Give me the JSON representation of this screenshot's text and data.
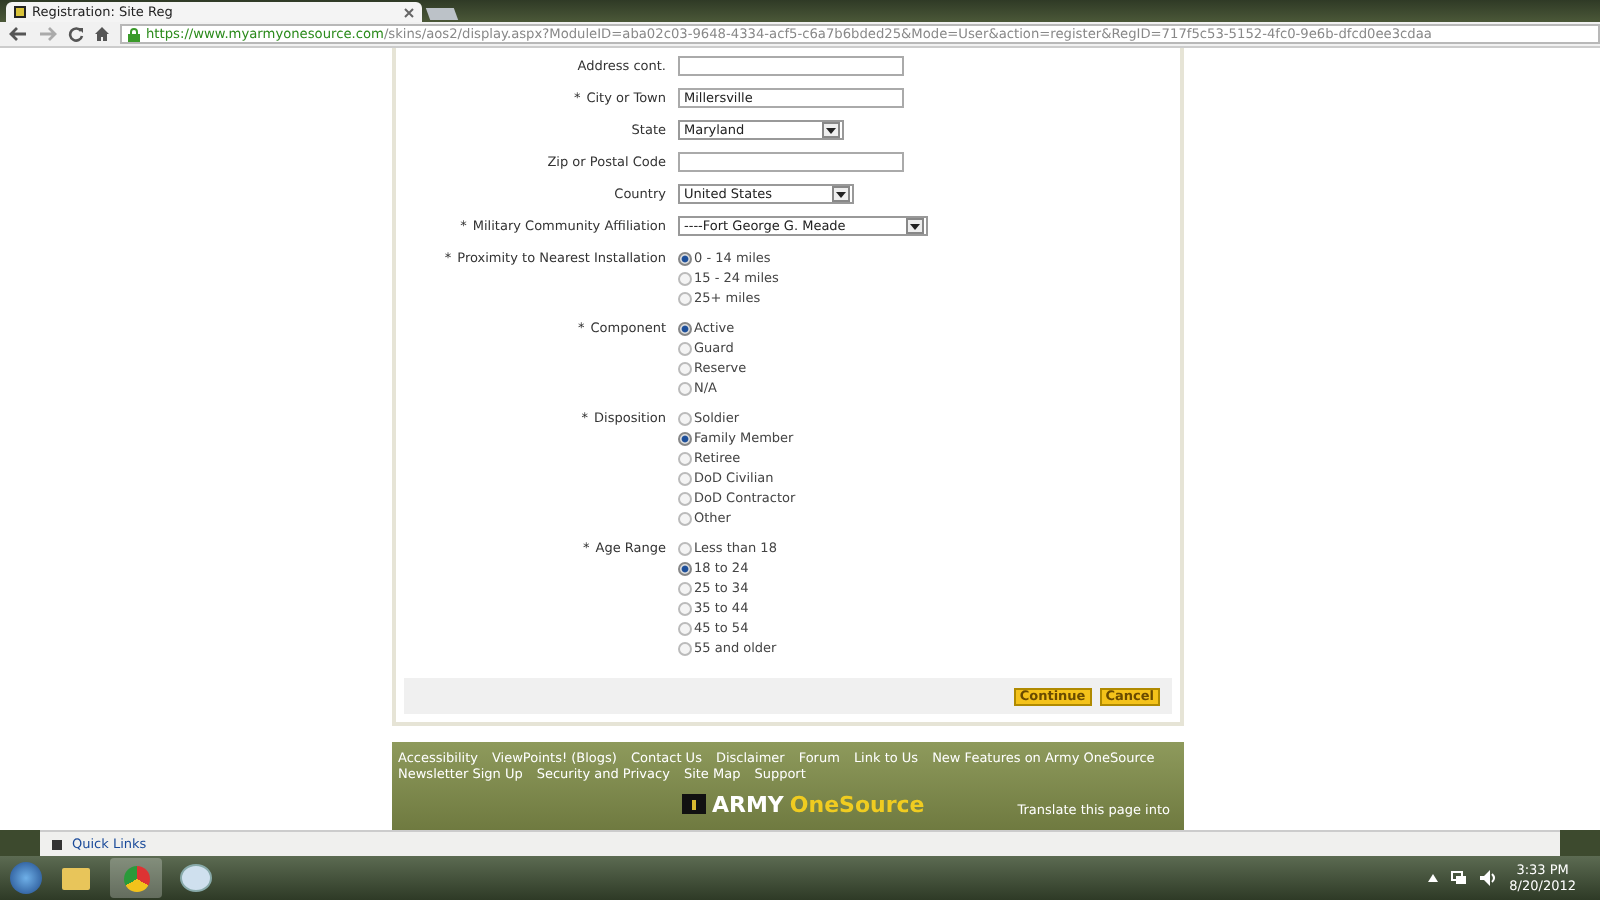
{
  "browser": {
    "tab_title": "Registration: Site Reg",
    "url_host": "https://www.myarmyonesource.com",
    "url_path": "/skins/aos2/display.aspx?ModuleID=aba02c03-9648-4334-acf5-c6a7b6bded25&Mode=User&action=register&RegID=717f5c53-5152-4fc0-9e6b-dfcd0ee3cdaa"
  },
  "form": {
    "fields": [
      {
        "kind": "text",
        "label": "Address cont.",
        "required": false
      },
      {
        "kind": "text",
        "label": "City or Town",
        "required": true,
        "value": "Millersville"
      },
      {
        "kind": "select",
        "label": "State",
        "required": false,
        "value": "Maryland"
      },
      {
        "kind": "text",
        "label": "Zip or Postal Code",
        "required": false
      },
      {
        "kind": "select",
        "label": "Country",
        "required": false,
        "value": "United States"
      },
      {
        "kind": "select",
        "label": "Military Community Affiliation",
        "required": true,
        "value": "----Fort George G. Meade"
      },
      {
        "kind": "radio",
        "label": "Proximity to Nearest Installation",
        "required": true,
        "options": [
          {
            "label": "0 - 14 miles",
            "selected": true
          },
          {
            "label": "15 - 24 miles",
            "selected": false
          },
          {
            "label": "25+ miles",
            "selected": false
          }
        ]
      },
      {
        "kind": "radio",
        "label": "Component",
        "required": true,
        "options": [
          {
            "label": "Active",
            "selected": true
          },
          {
            "label": "Guard",
            "selected": false
          },
          {
            "label": "Reserve",
            "selected": false
          },
          {
            "label": "N/A",
            "selected": false
          }
        ]
      },
      {
        "kind": "radio",
        "label": "Disposition",
        "required": true,
        "options": [
          {
            "label": "Soldier",
            "selected": false
          },
          {
            "label": "Family Member",
            "selected": true
          },
          {
            "label": "Retiree",
            "selected": false
          },
          {
            "label": "DoD Civilian",
            "selected": false
          },
          {
            "label": "DoD Contractor",
            "selected": false
          },
          {
            "label": "Other",
            "selected": false
          }
        ]
      },
      {
        "kind": "radio",
        "label": "Age Range",
        "required": true,
        "options": [
          {
            "label": "Less than 18",
            "selected": false
          },
          {
            "label": "18 to 24",
            "selected": true
          },
          {
            "label": "25 to 34",
            "selected": false
          },
          {
            "label": "35 to 44",
            "selected": false
          },
          {
            "label": "45 to 54",
            "selected": false
          },
          {
            "label": "55 and older",
            "selected": false
          }
        ]
      }
    ],
    "required_mark": "*",
    "buttons": [
      "Continue",
      "Cancel"
    ]
  },
  "footer": {
    "link_rows": [
      [
        "Accessibility",
        "ViewPoints! (Blogs)",
        "Contact Us",
        "Disclaimer",
        "Forum",
        "Link to Us",
        "New Features on Army OneSource"
      ],
      [
        "Newsletter Sign Up",
        "Security and Privacy",
        "Site Map",
        "Support"
      ]
    ],
    "logo_first": "ARMY",
    "logo_second": "OneSource",
    "translate": "Translate this page into"
  },
  "quick_links": "Quick Links",
  "taskbar": {
    "time": "3:33 PM",
    "date": "8/20/2012"
  }
}
